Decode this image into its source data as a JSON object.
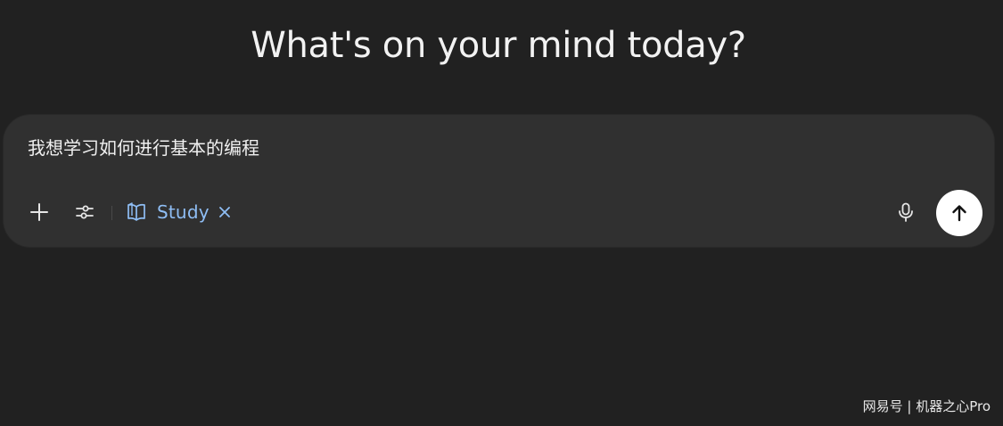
{
  "header": {
    "title": "What's on your mind today?"
  },
  "composer": {
    "input_value": "我想学习如何进行基本的编程",
    "tools": {
      "add_icon": "plus-icon",
      "tools_icon": "sliders-icon"
    },
    "mode_chip": {
      "label": "Study",
      "icon": "book-open-icon",
      "close_icon": "close-icon",
      "color": "#8fbef5"
    },
    "mic_icon": "microphone-icon",
    "send_icon": "arrow-up-icon"
  },
  "watermark": {
    "text": "网易号 | 机器之心Pro"
  },
  "colors": {
    "background": "#212121",
    "composer_background": "#303030",
    "send_button": "#ffffff"
  }
}
